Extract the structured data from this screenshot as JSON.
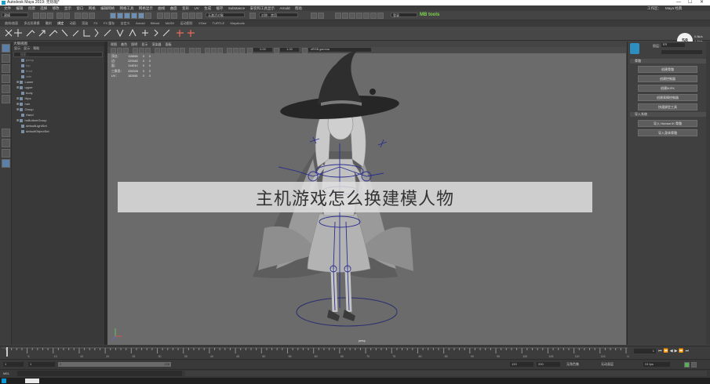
{
  "window": {
    "title": "Autodesk Maya 2019: 无标题*",
    "controls": [
      "—",
      "☐",
      "✕"
    ]
  },
  "menubar": {
    "items": [
      "文件",
      "编辑",
      "创建",
      "选择",
      "修改",
      "显示",
      "窗口",
      "网格",
      "编辑网格",
      "网格工具",
      "网格显示",
      "曲线",
      "曲面",
      "变形",
      "UV",
      "生成",
      "缓存",
      "Substance",
      "安装和工具显示",
      "Arnold",
      "帮助"
    ],
    "workspace_label": "工作区：",
    "workspace_value": "Maya 经典"
  },
  "statusline": {
    "mode": "建模",
    "render_label": "无激活对象",
    "user_label": "登录",
    "brand": "MB tools",
    "inject_label": "对称：禁用"
  },
  "shelf_tabs": [
    "曲线/曲面",
    "多边形建模",
    "雕刻",
    "绑定",
    "动画",
    "渲染",
    "FX",
    "FX 缓存",
    "自定义",
    "Arnold",
    "Bifrost",
    "MASH",
    "运动图形",
    "XGen",
    "TURTLE",
    "Mayatools"
  ],
  "outliner": {
    "title": "大纲视图",
    "menu": [
      "显示",
      "显示",
      "帮助"
    ],
    "search_placeholder": "搜索...",
    "rows": [
      {
        "label": "persp",
        "dim": true
      },
      {
        "label": "top",
        "dim": true
      },
      {
        "label": "front",
        "dim": true
      },
      {
        "label": "side",
        "dim": true
      },
      {
        "label": "Lower",
        "dim": false
      },
      {
        "label": "upper",
        "dim": false
      },
      {
        "label": "body",
        "dim": false
      },
      {
        "label": "Hips",
        "dim": false
      },
      {
        "label": "hair",
        "dim": false
      },
      {
        "label": "Group",
        "dim": false
      },
      {
        "label": "Hand",
        "dim": false
      },
      {
        "label": "hsBottomGroup",
        "dim": false
      },
      {
        "label": "defaultLightSet",
        "dim": false
      },
      {
        "label": "defaultObjectSet",
        "dim": false
      }
    ]
  },
  "viewport": {
    "menu": [
      "视图",
      "着色",
      "照明",
      "显示",
      "渲染器",
      "面板"
    ],
    "exposure": "0.00",
    "gamma": "1.00",
    "colorspace": "sRGB gamma",
    "hud": [
      [
        "顶点：",
        "115856",
        "0",
        "0"
      ],
      [
        "边：",
        "229482",
        "0",
        "0"
      ],
      [
        "面：",
        "114010",
        "0",
        "0"
      ],
      [
        "三角形：",
        "226326",
        "0",
        "0"
      ],
      [
        "UV：",
        "182681",
        "0",
        "0"
      ]
    ],
    "camera_label": "persp"
  },
  "attribute_panel": {
    "label_a": "图层：",
    "label_b": "ER",
    "section1": "骨骼",
    "buttons1": [
      "创建骨骼",
      "创建控制器",
      "创建IK/FK",
      "创建表情控制器",
      "快速绑定工具"
    ],
    "section2": "导入系统",
    "buttons2": [
      "导入 Human IK 骨骼",
      "导入身体骨骼"
    ]
  },
  "fps": {
    "value": "58",
    "stats_a": "0.8k/s",
    "stats_b": "1.1k/s"
  },
  "timeline": {
    "current_frame": "1",
    "end_frame": "120",
    "ticks": [
      "5",
      "10",
      "15",
      "20",
      "25",
      "30",
      "35",
      "40",
      "45",
      "50",
      "55",
      "60",
      "65",
      "70",
      "75",
      "80",
      "85",
      "90",
      "95",
      "100",
      "105",
      "110",
      "115",
      "120"
    ]
  },
  "range": {
    "start": "1",
    "start2": "1",
    "range_start": "1",
    "range_end": "120",
    "end": "120",
    "end2": "200",
    "char_label": "无角色集",
    "anim_label": "无动画层",
    "fps_label": "24 fps"
  },
  "cmdline": {
    "lang": "MEL"
  },
  "overlay_text": "主机游戏怎么换建模人物"
}
